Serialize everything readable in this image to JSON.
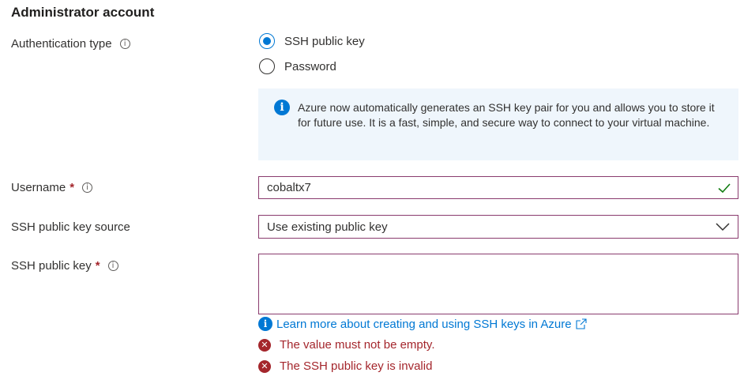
{
  "section": {
    "title": "Administrator account"
  },
  "auth": {
    "label": "Authentication type",
    "options": [
      {
        "label": "SSH public key",
        "selected": true
      },
      {
        "label": "Password",
        "selected": false
      }
    ],
    "info_text": "Azure now automatically generates an SSH key pair for you and allows you to store it for future use. It is a fast, simple, and secure way to connect to your virtual machine."
  },
  "username": {
    "label": "Username",
    "required_mark": "*",
    "value": "cobaltx7"
  },
  "key_source": {
    "label": "SSH public key source",
    "value": "Use existing public key"
  },
  "public_key": {
    "label": "SSH public key",
    "required_mark": "*",
    "value": "",
    "link_text": "Learn more about creating and using SSH keys in Azure",
    "errors": [
      "The value must not be empty.",
      "The SSH public key is invalid"
    ]
  },
  "colors": {
    "accent": "#0078d4",
    "error": "#a4262c",
    "field_border": "#8a3b6e",
    "success": "#107c10",
    "info_bg": "#eff6fc"
  },
  "icons": [
    "info-circle-icon",
    "checkmark-icon",
    "chevron-down-icon",
    "info-filled-icon",
    "external-link-icon",
    "error-icon"
  ]
}
